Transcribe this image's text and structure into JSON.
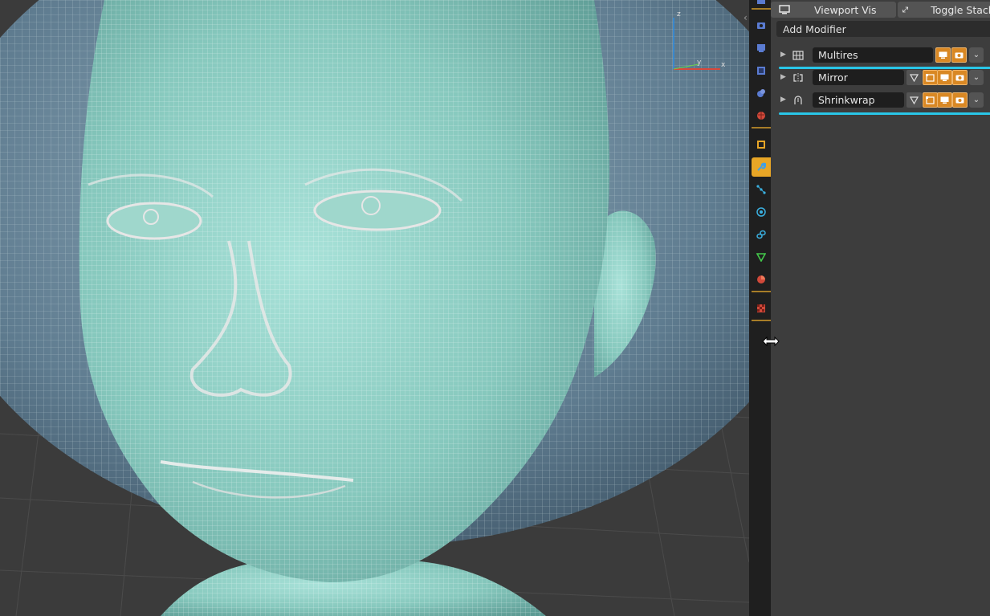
{
  "viewport": {
    "axes": {
      "z_label": "z",
      "y_label": "y",
      "x_label": "x"
    },
    "collapse_glyph": "‹"
  },
  "tabs": [
    {
      "name": "tool-tab",
      "color": "#5a7bd1"
    },
    {
      "name": "render-tab",
      "color": "#5a7bd1"
    },
    {
      "name": "output-tab",
      "color": "#5a7bd1"
    },
    {
      "name": "view-layer-tab",
      "color": "#5a7bd1"
    },
    {
      "name": "scene-tab",
      "color": "#5a7bd1"
    },
    {
      "name": "world-tab",
      "color": "#d1493a"
    },
    {
      "name": "object-tab",
      "color": "#e8a626"
    },
    {
      "name": "modifier-tab",
      "color": "#5fa3e8",
      "active": true
    },
    {
      "name": "particles-tab",
      "color": "#3ab0e0"
    },
    {
      "name": "physics-tab",
      "color": "#3ab0e0"
    },
    {
      "name": "constraints-tab",
      "color": "#3ab0e0"
    },
    {
      "name": "data-tab",
      "color": "#43c84a"
    },
    {
      "name": "material-tab",
      "color": "#d1493a"
    },
    {
      "name": "texture-tab",
      "color": "#d1493a"
    }
  ],
  "panel": {
    "viewport_vis_label": "Viewport Vis",
    "toggle_stack_label": "Toggle Stack",
    "add_modifier_label": "Add Modifier",
    "modifiers": [
      {
        "name": "Multires",
        "icon": "multires-icon"
      },
      {
        "name": "Mirror",
        "icon": "mirror-icon"
      },
      {
        "name": "Shrinkwrap",
        "icon": "shrinkwrap-icon"
      }
    ],
    "dropdown_glyph": "⌄",
    "expand_glyph": "▶"
  },
  "colors": {
    "accent_orange": "#d98824",
    "active_tab": "#e8a626",
    "highlight_line": "#29c6e8"
  }
}
